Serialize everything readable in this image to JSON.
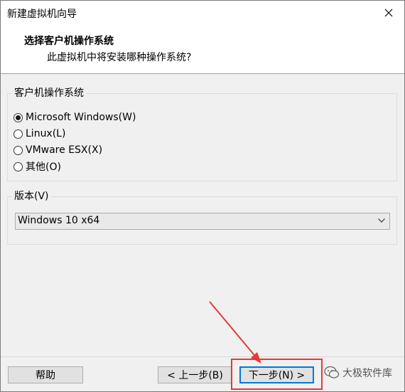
{
  "window": {
    "title": "新建虚拟机向导"
  },
  "header": {
    "title": "选择客户机操作系统",
    "subtitle": "此虚拟机中将安装哪种操作系统?"
  },
  "guest_os_group": {
    "label": "客户机操作系统",
    "options": [
      {
        "label": "Microsoft Windows(W)",
        "checked": true
      },
      {
        "label": "Linux(L)",
        "checked": false
      },
      {
        "label": "VMware ESX(X)",
        "checked": false
      },
      {
        "label": "其他(O)",
        "checked": false
      }
    ]
  },
  "version_group": {
    "label": "版本(V)",
    "selected": "Windows 10 x64"
  },
  "buttons": {
    "help": "帮助",
    "back": "< 上一步(B)",
    "next": "下一步(N) >"
  },
  "watermark": {
    "text": "大极软件库"
  },
  "colors": {
    "annotation": "#e53935",
    "default_button_border": "#0078d7"
  },
  "icons": [
    "close-icon",
    "chevron-down-icon",
    "wechat-icon",
    "arrow-annotation"
  ]
}
